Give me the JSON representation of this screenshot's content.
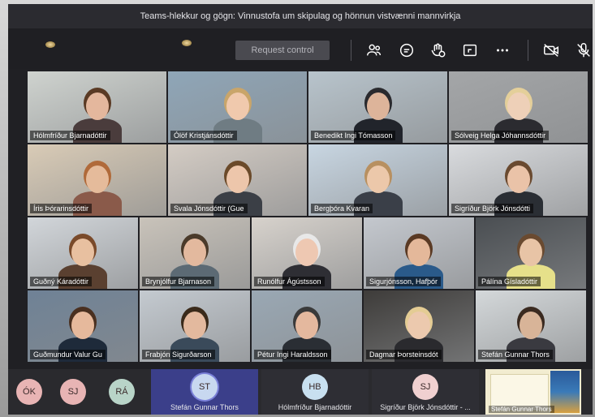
{
  "window": {
    "title": "Teams-hlekkur og gögn: Vinnustofa um skipulag og hönnun vistvænni mannvirkja"
  },
  "toolbar": {
    "request_control_label": "Request control",
    "icons": [
      "participants-icon",
      "chat-icon",
      "reactions-icon",
      "share-tray-icon",
      "more-icon",
      "camera-off-icon",
      "mic-off-icon"
    ]
  },
  "participants": [
    {
      "name": "Hólmfríður Bjarnadóttir",
      "bg": "#cfd3cf",
      "skin": "#e4b79d",
      "shirt": "#4a3c3c",
      "hair": "#5a3a24"
    },
    {
      "name": "Ólöf Kristjánsdóttir",
      "bg": "#8fa6b8",
      "skin": "#f0c9ad",
      "shirt": "#6f7c83",
      "hair": "#c9a56a"
    },
    {
      "name": "Benedikt Ingi Tómasson",
      "bg": "#b8c4cc",
      "skin": "#ddb49a",
      "shirt": "#21242b",
      "hair": "#2a2a2e"
    },
    {
      "name": "Sólveig Helga Jóhannsdóttir",
      "bg": "#a4a6a8",
      "skin": "#eed0b8",
      "shirt": "#2b2b30",
      "hair": "#e4cf9a"
    },
    {
      "name": "Íris Þórarinsdóttir",
      "bg": "#d9cbb6",
      "skin": "#e5bb9b",
      "shirt": "#8a5a4a",
      "hair": "#b06a3a"
    },
    {
      "name": "Svala Jónsdóttir (Gue",
      "bg": "#d4ccc4",
      "skin": "#edc6ab",
      "shirt": "#3b3f46",
      "hair": "#6b4a2a"
    },
    {
      "name": "Bergþóra Kvaran",
      "bg": "#c8d6e2",
      "skin": "#ecc8aa",
      "shirt": "#3a3f48",
      "hair": "#b89060"
    },
    {
      "name": "Sigríður Björk Jónsdótti",
      "bg": "#d9dbde",
      "skin": "#eac3a8",
      "shirt": "#2a2e34",
      "hair": "#6a4a30"
    },
    {
      "name": "Guðný Káradóttir",
      "bg": "#d2d6da",
      "skin": "#e8c0a0",
      "shirt": "#5a4030",
      "hair": "#7a4a2a"
    },
    {
      "name": "Brynjólfur Bjarnason",
      "bg": "#c9c3ba",
      "skin": "#e3b99e",
      "shirt": "#5c6a74",
      "hair": "#4a3a2a"
    },
    {
      "name": "Runólfur Ágústsson",
      "bg": "#d7d2cc",
      "skin": "#eec8b2",
      "shirt": "#2e2e34",
      "hair": "#e8e8e8"
    },
    {
      "name": "Sigurjónsson, Hafþór",
      "bg": "#c4c8ce",
      "skin": "#e4b89a",
      "shirt": "#2a5a8a",
      "hair": "#5a3a24"
    },
    {
      "name": "Pálína Gísladóttir",
      "bg": "#4a4e52",
      "skin": "#e8c4a6",
      "shirt": "#e6e08a",
      "hair": "#6a4a30"
    },
    {
      "name": "Guðmundur Valur Gu",
      "bg": "#6f8296",
      "skin": "#e6b99c",
      "shirt": "#1e2a3a",
      "hair": "#4a3020"
    },
    {
      "name": "Frabjón Sigurðarson",
      "bg": "#c4cad0",
      "skin": "#e3b99e",
      "shirt": "#3a4a5a",
      "hair": "#3a2a1a"
    },
    {
      "name": "Pétur Ingi Haraldsson",
      "bg": "#9aa8b4",
      "skin": "#e4b89e",
      "shirt": "#2a2e34",
      "hair": "#3a3a3a"
    },
    {
      "name": "Dagmar Þorsteinsdót",
      "bg": "#3e3c3a",
      "skin": "#ecc9ae",
      "shirt": "#2a2a2e",
      "hair": "#e4cc94"
    },
    {
      "name": "Stefán Gunnar Thors",
      "bg": "#d4d8da",
      "skin": "#d8b498",
      "shirt": "#3a3a40",
      "hair": "#3a2a20"
    }
  ],
  "bottom_bar": {
    "avatars": [
      {
        "initials": "ÓK",
        "color": "#e8b4b4"
      },
      {
        "initials": "SJ",
        "color": "#e8b4b4"
      },
      {
        "initials": "RÁ",
        "color": "#b8d4c8"
      }
    ],
    "tiles": [
      {
        "initials": "ST",
        "name": "Stefán Gunnar Thors",
        "color": "#c8d8f0",
        "bg": "#3b3f8a"
      },
      {
        "initials": "HB",
        "name": "Hólmfríður Bjarnadóttir",
        "color": "#c8e0f0",
        "bg": "#2e2e34"
      },
      {
        "initials": "SJ",
        "name": "Sigríður Björk Jónsdóttir - ...",
        "color": "#f0d0d0",
        "bg": "#2e2e34"
      }
    ],
    "shared_doc_label": "Stefán Gunnar Thors"
  }
}
